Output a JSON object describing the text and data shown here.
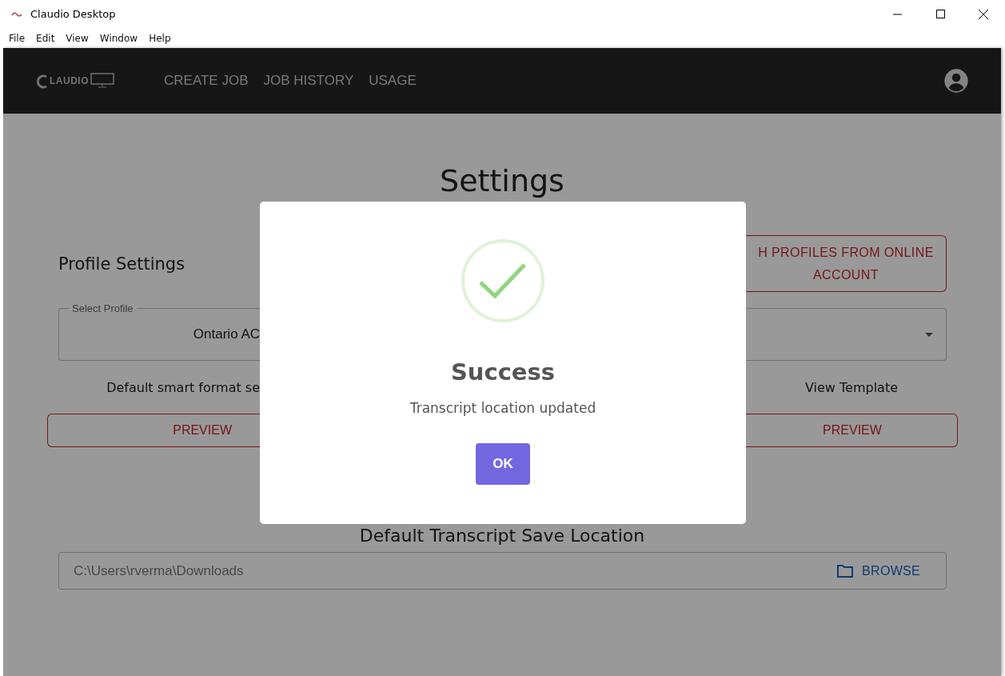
{
  "window": {
    "title": "Claudio Desktop"
  },
  "menu": [
    "File",
    "Edit",
    "View",
    "Window",
    "Help"
  ],
  "nav": {
    "logo": "LAUDIO",
    "links": [
      "CREATE JOB",
      "JOB HISTORY",
      "USAGE"
    ]
  },
  "page": {
    "title": "Settings",
    "profile_heading": "Profile Settings",
    "sync_button": [
      "H PROFILES FROM ONLINE",
      "ACCOUNT"
    ],
    "select": {
      "label": "Select Profile",
      "value": "Ontario AC"
    },
    "left_caption": "Default smart format se",
    "right_caption": "View Template",
    "preview_buttons": [
      "PREVIEW",
      "PREVIEW"
    ],
    "save_heading": "Default Transcript Save Location",
    "path": {
      "value": "C:\\Users\\rverma\\Downloads",
      "button": "BROWSE"
    }
  },
  "dialog": {
    "title": "Success",
    "message": "Transcript location updated",
    "button": "OK"
  }
}
